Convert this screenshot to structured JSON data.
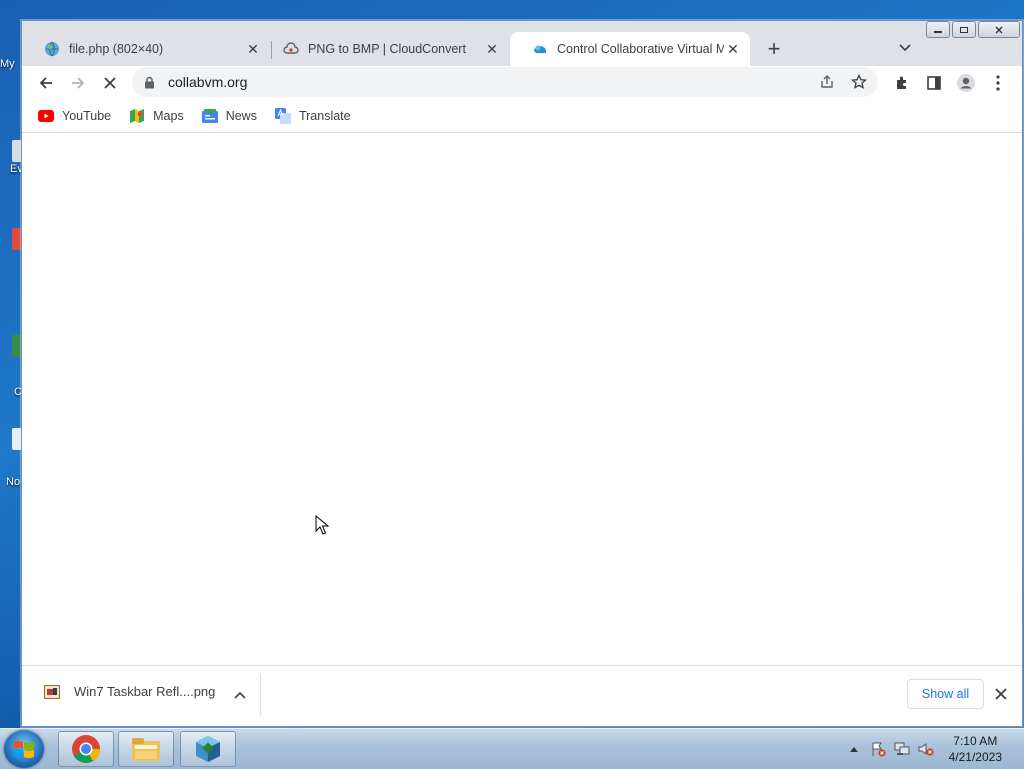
{
  "desktop": {
    "icon_fragments": [
      "My",
      "Ev",
      "C",
      "No"
    ]
  },
  "browser": {
    "tabs": [
      {
        "title": "file.php (802×40)",
        "favicon": "globe-icon",
        "active": false
      },
      {
        "title": "PNG to BMP | CloudConvert",
        "favicon": "cloudconvert-icon",
        "active": false
      },
      {
        "title": "Control Collaborative Virtual Ma",
        "favicon": "collabvm-icon",
        "active": true
      }
    ],
    "new_tab_label": "+",
    "address_bar": {
      "url": "collabvm.org"
    },
    "bookmarks": [
      {
        "label": "YouTube",
        "icon": "youtube-icon"
      },
      {
        "label": "Maps",
        "icon": "maps-icon"
      },
      {
        "label": "News",
        "icon": "news-icon"
      },
      {
        "label": "Translate",
        "icon": "translate-icon"
      }
    ],
    "download_bar": {
      "file_name": "Win7 Taskbar Refl....png",
      "show_all_label": "Show all"
    }
  },
  "taskbar": {
    "apps": [
      "chrome-icon",
      "explorer-icon",
      "virtualbox-icon"
    ],
    "clock": {
      "time": "7:10 AM",
      "date": "4/21/2023"
    }
  },
  "colors": {
    "accent": "#1a73e8",
    "tabstrip": "#dee1e6",
    "omnibox": "#f1f3f4"
  }
}
